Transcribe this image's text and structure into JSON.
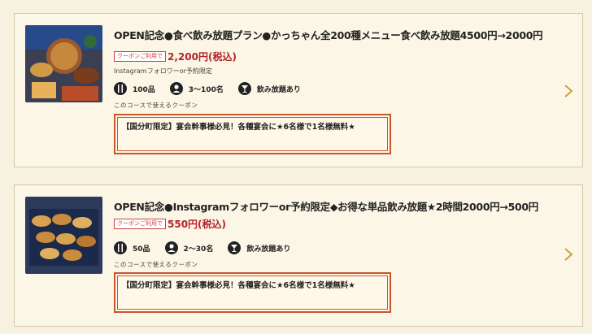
{
  "courses": [
    {
      "title": "OPEN記念●食べ飲み放題プラン●かっちゃん全200種メニュー食べ飲み放題4500円→2000円",
      "coupon_badge": "クーポンご利用で",
      "price": "2,200円(税込)",
      "note": "Instagramフォロワーor予約限定",
      "dishes": "100品",
      "people": "3～100名",
      "drink": "飲み放題あり",
      "coupon_label": "このコースで使えるクーポン",
      "coupon_text": "【国分町限定】宴会幹事様必見！各種宴会に★6名様で1名様無料★"
    },
    {
      "title": "OPEN記念●Instagramフォロワーor予約限定◆お得な単品飲み放題★2時間2000円→500円",
      "coupon_badge": "クーポンご利用で",
      "price": "550円(税込)",
      "dishes": "50品",
      "people": "2～30名",
      "drink": "飲み放題あり",
      "coupon_label": "このコースで使えるクーポン",
      "coupon_text": "【国分町限定】宴会幹事様必見！各種宴会に★6名様で1名様無料★"
    }
  ],
  "colors": {
    "accent": "#b3242b",
    "border": "#c8562b",
    "chevron": "#c9a23c"
  }
}
